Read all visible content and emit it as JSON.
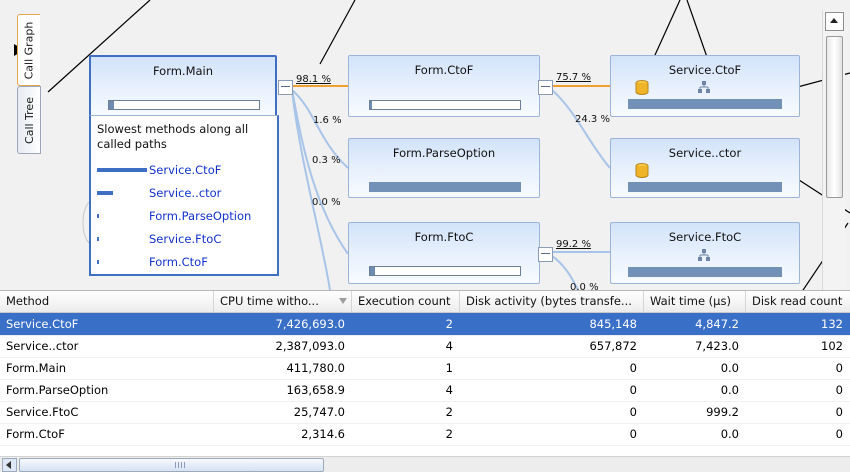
{
  "tabs": {
    "call_graph": "Call Graph",
    "call_tree": "Call Tree"
  },
  "nodes": {
    "form_main": {
      "title": "Form.Main",
      "bar_fill": 0.03
    },
    "form_ctof": {
      "title": "Form.CtoF",
      "bar_fill": 0.01
    },
    "form_parseoption": {
      "title": "Form.ParseOption"
    },
    "form_ftoc": {
      "title": "Form.FtoC",
      "bar_fill": 0.03
    },
    "service_ctof": {
      "title": "Service.CtoF"
    },
    "service_ctor": {
      "title": "Service..ctor"
    },
    "service_ftoc": {
      "title": "Service.FtoC"
    }
  },
  "legend": {
    "caption": "Slowest methods along all called paths",
    "items": [
      {
        "label": "Service.CtoF",
        "weight": 1.0
      },
      {
        "label": "Service..ctor",
        "weight": 0.32
      },
      {
        "label": "Form.ParseOption",
        "weight": 0.02
      },
      {
        "label": "Service.FtoC",
        "weight": 0.01
      },
      {
        "label": "Form.CtoF",
        "weight": 0.01
      }
    ]
  },
  "percentages": {
    "main_to_ctof": "98.1 %",
    "main_to_second": "1.6 %",
    "main_to_parseoption": "0.3 %",
    "main_to_ftoc": "0.0 %",
    "ctof_to_service_ctof": "75.7 %",
    "ctof_to_service_ctor": "24.3 %",
    "ftoc_to_service_ftoc": "99.2 %",
    "ftoc_partial": "0.0 %"
  },
  "colors": {
    "hot_edge": "#f0a030",
    "cold_edge": "#a8c4e8",
    "selection": "#3a6fc7",
    "accent": "#3f6fc3"
  },
  "grid": {
    "columns": [
      "Method",
      "CPU time witho...",
      "Execution count",
      "Disk activity (bytes transfe...",
      "Wait time (μs)",
      "Disk read count"
    ],
    "sorted_column": 1,
    "selected_row": 0,
    "rows": [
      [
        "Service.CtoF",
        "7,426,693.0",
        "2",
        "845,148",
        "4,847.2",
        "132"
      ],
      [
        "Service..ctor",
        "2,387,093.0",
        "4",
        "657,872",
        "7,423.0",
        "102"
      ],
      [
        "Form.Main",
        "411,780.0",
        "1",
        "0",
        "0.0",
        "0"
      ],
      [
        "Form.ParseOption",
        "163,658.9",
        "4",
        "0",
        "0.0",
        "0"
      ],
      [
        "Service.FtoC",
        "25,747.0",
        "2",
        "0",
        "999.2",
        "0"
      ],
      [
        "Form.CtoF",
        "2,314.6",
        "2",
        "0",
        "0.0",
        "0"
      ]
    ]
  }
}
